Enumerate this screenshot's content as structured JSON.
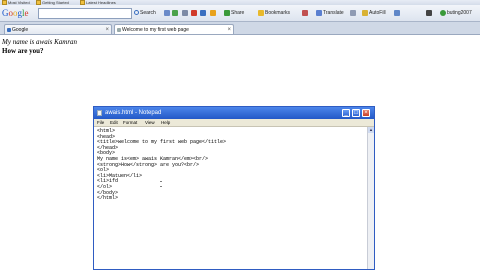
{
  "bookmarks": [
    {
      "label": "Most Visited"
    },
    {
      "label": "Getting Started"
    },
    {
      "label": "Latest Headlines"
    }
  ],
  "toolbar": {
    "search_label": "Search",
    "items": [
      {
        "label": "Share",
        "icon": "share-icon"
      },
      {
        "label": "Bookmarks",
        "icon": "bookmarks-icon"
      },
      {
        "label": "Translate",
        "icon": "translate-icon"
      },
      {
        "label": "AutoFill",
        "icon": "autofill-icon"
      },
      {
        "label": "buting2007",
        "icon": "user-icon"
      }
    ]
  },
  "tabs": [
    {
      "label": "Google"
    },
    {
      "label": "Welcome to my first web page"
    }
  ],
  "page": {
    "line1": "My name is awais Kamran",
    "line2": "How are you?"
  },
  "notepad": {
    "title": "awais.html - Notepad",
    "menu": [
      "File",
      "Edit",
      "Format",
      "View",
      "Help"
    ],
    "lines": [
      "<html>",
      "<head>",
      "<title>welcome to my first web page</title>",
      "</head>",
      "<body>",
      "My name is<em> awais Kamran</em><br/>",
      "<strong>How</strong> are you?<br/>",
      "<ol>",
      "<li>Matuen</li>",
      "<li>ifd",
      "</ol>",
      "</body>",
      "</html>"
    ]
  },
  "colors": {
    "titlebar": "#2358c7",
    "menubar": "#ece9d8"
  }
}
